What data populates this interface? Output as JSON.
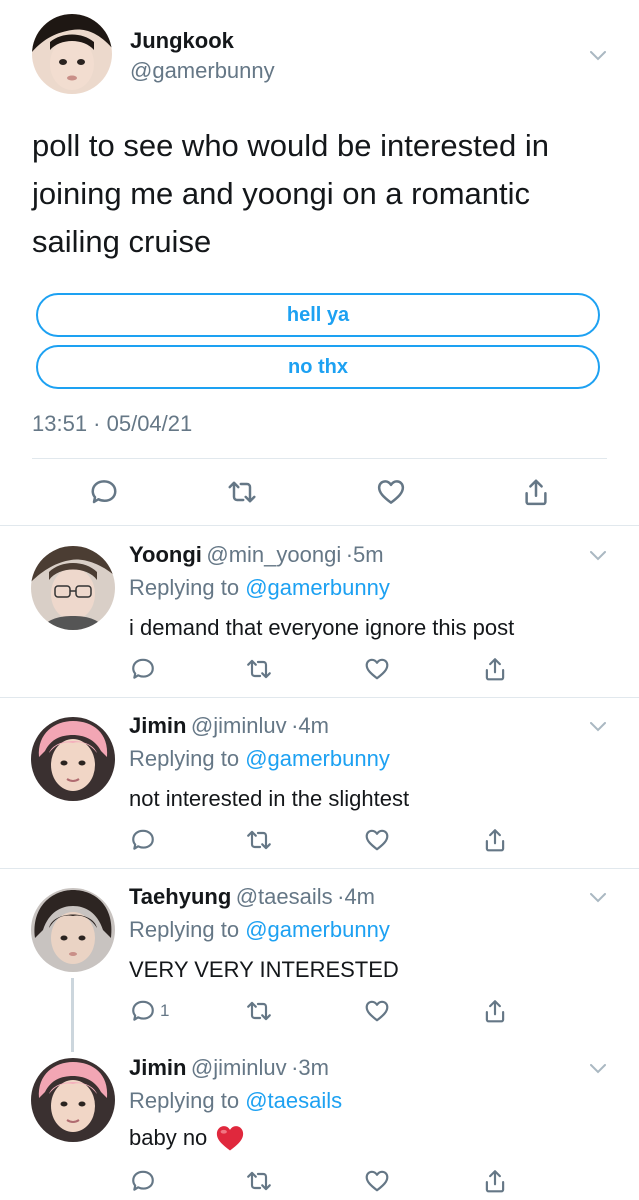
{
  "main_tweet": {
    "name": "Jungkook",
    "handle": "@gamerbunny",
    "text": "poll to see who would be interested in joining me and yoongi on a romantic sailing cruise",
    "poll_options": [
      "hell ya",
      "no thx"
    ],
    "timestamp": "13:51 · 05/04/21"
  },
  "replies": [
    {
      "name": "Yoongi",
      "handle": "@min_yoongi",
      "time": "5m",
      "replying_label": "Replying to ",
      "replying_to": "@gamerbunny",
      "text": "i demand that everyone ignore this post",
      "reply_count": ""
    },
    {
      "name": "Jimin",
      "handle": "@jiminluv",
      "time": "4m",
      "replying_label": "Replying to ",
      "replying_to": "@gamerbunny",
      "text": "not interested in the slightest",
      "reply_count": ""
    },
    {
      "name": "Taehyung",
      "handle": "@taesails",
      "time": "4m",
      "replying_label": "Replying to ",
      "replying_to": "@gamerbunny",
      "text": "VERY VERY INTERESTED",
      "reply_count": "1"
    },
    {
      "name": "Jimin",
      "handle": "@jiminluv",
      "time": "3m",
      "replying_label": "Replying to ",
      "replying_to": "@taesails",
      "text": "baby no",
      "reply_count": ""
    }
  ],
  "separator": "·",
  "icons": {
    "reply": "speech-bubble-icon",
    "retweet": "retweet-arrows-icon",
    "like": "heart-icon",
    "share": "share-upload-icon",
    "menu": "chevron-down-icon",
    "emoji": "red-heart-emoji"
  },
  "colors": {
    "link": "#1da1f2",
    "muted": "#657786",
    "divider": "#e1e8ed",
    "heart": "#e0245e"
  }
}
